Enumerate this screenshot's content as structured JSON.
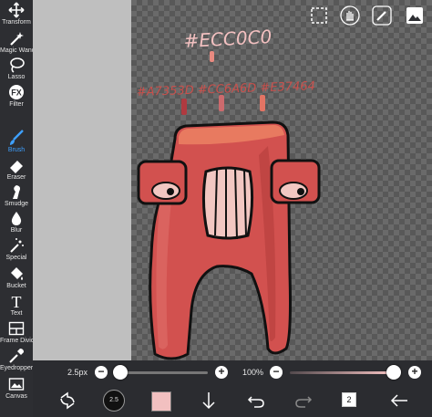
{
  "toolbar": {
    "tools": [
      {
        "label": "Transform",
        "icon": "transform-icon"
      },
      {
        "label": "Magic Wand",
        "icon": "magic-wand-icon"
      },
      {
        "label": "Lasso",
        "icon": "lasso-icon"
      },
      {
        "label": "Filter",
        "icon": "filter-icon",
        "icon_text": "FX"
      },
      {
        "label": "Brush",
        "icon": "brush-icon",
        "active": true
      },
      {
        "label": "Eraser",
        "icon": "eraser-icon"
      },
      {
        "label": "Smudge",
        "icon": "smudge-icon"
      },
      {
        "label": "Blur",
        "icon": "blur-icon"
      },
      {
        "label": "Special",
        "icon": "special-icon"
      },
      {
        "label": "Bucket",
        "icon": "bucket-icon"
      },
      {
        "label": "Text",
        "icon": "text-icon",
        "icon_text": "T"
      },
      {
        "label": "Frame Divider",
        "icon": "frame-divider-icon"
      },
      {
        "label": "Eyedropper",
        "icon": "eyedropper-icon"
      },
      {
        "label": "Canvas",
        "icon": "canvas-icon"
      }
    ],
    "active_color": "#3ea0ff"
  },
  "canvas": {
    "handwritten_hex_top": "#ECC0C0",
    "handwritten_hex_row": "#A7353D #CC6A6D #E37464",
    "letter_colors": {
      "body": "#d2514f",
      "top": "#e87a60",
      "outline": "#111111",
      "eye_white": "#f2c7c2"
    }
  },
  "sliders": {
    "brush_size": "2.5px",
    "opacity": "100%",
    "minus": "−",
    "plus": "+"
  },
  "bottombar": {
    "brush_size_label": "2.5",
    "color": "#f2c0c0",
    "layer_count": "2"
  }
}
